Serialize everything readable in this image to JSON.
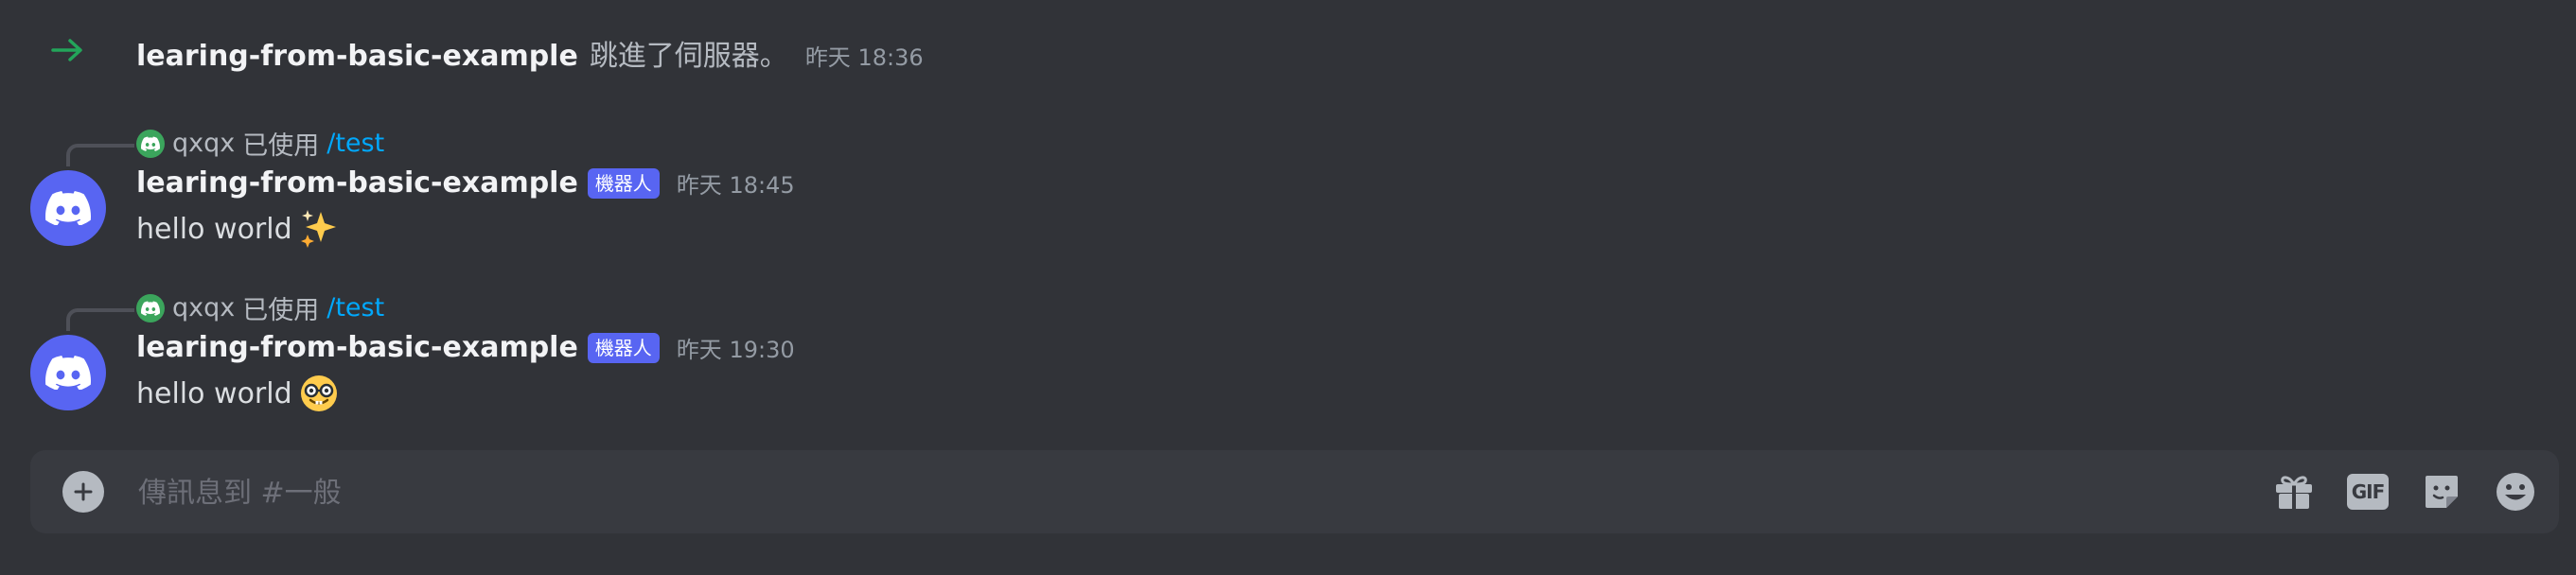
{
  "system_message": {
    "icon": "arrow-right-icon",
    "username": "learing-from-basic-example",
    "text": "跳進了伺服器。",
    "timestamp": "昨天 18:36"
  },
  "messages": [
    {
      "reply": {
        "username": "qxqx",
        "verb": "已使用",
        "command": "/test"
      },
      "author": "learing-from-basic-example",
      "bot_tag": "機器人",
      "timestamp": "昨天 18:45",
      "text": "hello world",
      "emoji": "sparkles-emoji"
    },
    {
      "reply": {
        "username": "qxqx",
        "verb": "已使用",
        "command": "/test"
      },
      "author": "learing-from-basic-example",
      "bot_tag": "機器人",
      "timestamp": "昨天 19:30",
      "text": "hello world",
      "emoji": "nerd-face-emoji"
    }
  ],
  "composer": {
    "placeholder": "傳訊息到 #一般",
    "gif_label": "GIF",
    "icons": [
      "plus-circle-icon",
      "gift-icon",
      "gif-icon",
      "sticker-icon",
      "emoji-icon"
    ]
  },
  "colors": {
    "background": "#313338",
    "composer": "#383a40",
    "bot_tag": "#5865f2",
    "join_arrow": "#23a55a",
    "command_link": "#00a8fc"
  }
}
